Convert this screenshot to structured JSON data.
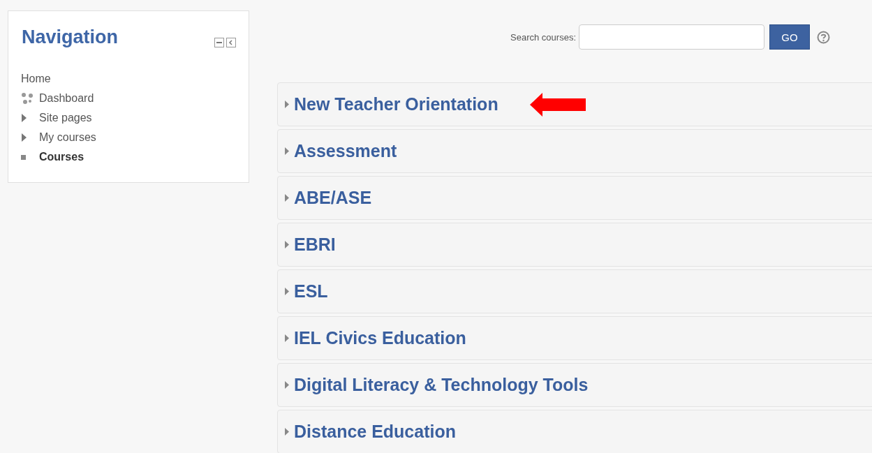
{
  "navigation": {
    "title": "Navigation",
    "items": [
      {
        "label": "Home",
        "kind": "plain",
        "current": false
      },
      {
        "label": "Dashboard",
        "kind": "dashboard",
        "current": false
      },
      {
        "label": "Site pages",
        "kind": "branch",
        "current": false
      },
      {
        "label": "My courses",
        "kind": "branch",
        "current": false
      },
      {
        "label": "Courses",
        "kind": "leaf",
        "current": true
      }
    ]
  },
  "search": {
    "label": "Search courses:",
    "button": "GO"
  },
  "categories": [
    {
      "name": "New Teacher Orientation",
      "pointed": true
    },
    {
      "name": "Assessment",
      "pointed": false
    },
    {
      "name": "ABE/ASE",
      "pointed": false
    },
    {
      "name": "EBRI",
      "pointed": false
    },
    {
      "name": "ESL",
      "pointed": false
    },
    {
      "name": "IEL Civics Education",
      "pointed": false
    },
    {
      "name": "Digital Literacy & Technology Tools",
      "pointed": false
    },
    {
      "name": "Distance Education",
      "pointed": false
    }
  ]
}
